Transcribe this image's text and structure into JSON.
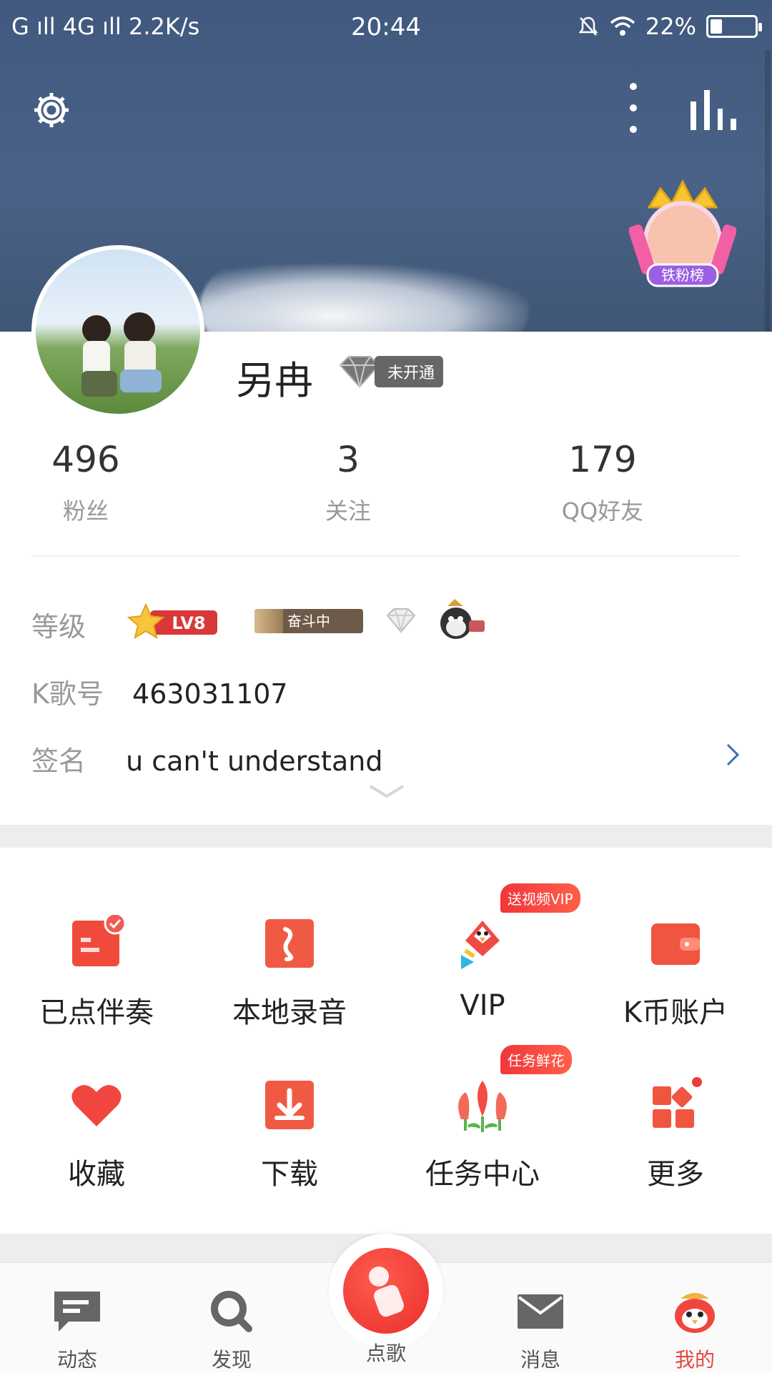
{
  "status_bar": {
    "left": "G ıll 4G ıll 2.2K/s",
    "time": "20:44",
    "battery": "22%"
  },
  "profile": {
    "username": "另冉",
    "vip_status": "未开通",
    "fan_badge_label": "铁粉榜"
  },
  "stats": [
    {
      "value": "496",
      "label": "粉丝"
    },
    {
      "value": "3",
      "label": "关注"
    },
    {
      "value": "179",
      "label": "QQ好友"
    }
  ],
  "info": {
    "level_label": "等级",
    "level_badge": "LV8",
    "fight_badge": "奋斗中",
    "kid_label": "K歌号",
    "kid_value": "463031107",
    "sign_label": "签名",
    "sign_value": "u can't understand"
  },
  "grid": [
    {
      "label": "已点伴奏",
      "icon": "accompaniment-icon"
    },
    {
      "label": "本地录音",
      "icon": "local-recording-icon"
    },
    {
      "label": "VIP",
      "icon": "vip-icon",
      "tag": "送视频VIP"
    },
    {
      "label": "K币账户",
      "icon": "wallet-icon"
    },
    {
      "label": "收藏",
      "icon": "heart-icon"
    },
    {
      "label": "下载",
      "icon": "download-icon"
    },
    {
      "label": "任务中心",
      "icon": "flower-icon",
      "tag": "任务鲜花"
    },
    {
      "label": "更多",
      "icon": "more-grid-icon"
    }
  ],
  "nav": [
    {
      "label": "动态"
    },
    {
      "label": "发现"
    },
    {
      "label": "点歌"
    },
    {
      "label": "消息"
    },
    {
      "label": "我的"
    }
  ],
  "colors": {
    "accent": "#e8463e",
    "cover": "#4a6287"
  }
}
